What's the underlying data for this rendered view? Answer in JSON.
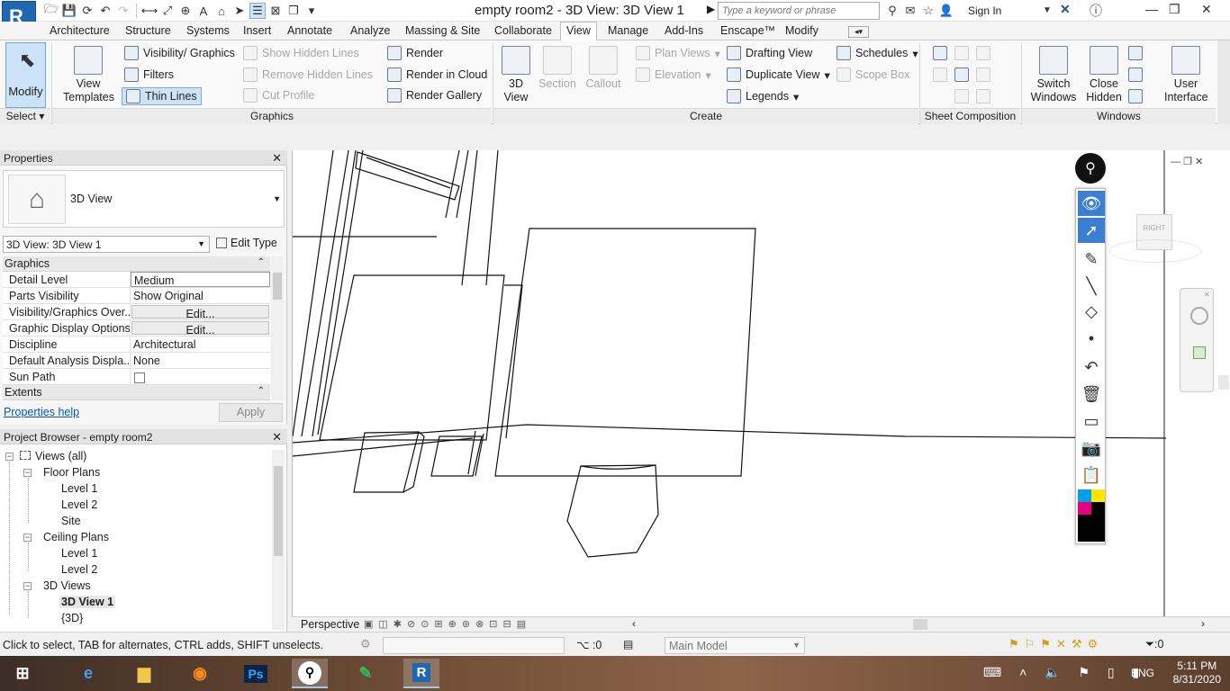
{
  "app": {
    "logo_letter": "R",
    "title": "empty room2 - 3D View: 3D View 1",
    "search_placeholder": "Type a keyword or phrase",
    "sign_in": "Sign In"
  },
  "tabs": [
    "Architecture",
    "Structure",
    "Systems",
    "Insert",
    "Annotate",
    "Analyze",
    "Massing & Site",
    "Collaborate",
    "View",
    "Manage",
    "Add-Ins",
    "Enscape™",
    "Modify"
  ],
  "active_tab": "View",
  "ribbon": {
    "select": {
      "modify": "Modify",
      "panel": "Select"
    },
    "graphics": {
      "view_templates": "View Templates",
      "visibility": "Visibility/ Graphics",
      "filters": "Filters",
      "thin_lines": "Thin Lines",
      "show_hidden": "Show  Hidden Lines",
      "remove_hidden": "Remove  Hidden Lines",
      "cut_profile": "Cut  Profile",
      "render": "Render",
      "render_cloud": "Render  in Cloud",
      "render_gallery": "Render  Gallery",
      "panel": "Graphics"
    },
    "create": {
      "view3d": "3D View",
      "section": "Section",
      "callout": "Callout",
      "plan_views": "Plan  Views",
      "elevation": "Elevation",
      "drafting": "Drafting  View",
      "duplicate": "Duplicate  View",
      "legends": "Legends",
      "schedules": "Schedules",
      "scope_box": "Scope  Box",
      "panel": "Create"
    },
    "sheet": {
      "panel": "Sheet Composition"
    },
    "windows": {
      "switch": "Switch Windows",
      "close_hidden": "Close Hidden",
      "user_interface": "User Interface",
      "panel": "Windows"
    }
  },
  "properties": {
    "title": "Properties",
    "type_name": "3D View",
    "view_selector": "3D View: 3D View 1",
    "edit_type": "Edit Type",
    "group_graphics": "Graphics",
    "rows": [
      {
        "k": "Detail Level",
        "v": "Medium"
      },
      {
        "k": "Parts Visibility",
        "v": "Show Original"
      },
      {
        "k": "Visibility/Graphics Over...",
        "v": "Edit..."
      },
      {
        "k": "Graphic Display Options",
        "v": "Edit..."
      },
      {
        "k": "Discipline",
        "v": "Architectural"
      },
      {
        "k": "Default Analysis Displa...",
        "v": "None"
      },
      {
        "k": "Sun Path",
        "v": ""
      }
    ],
    "group_extents": "Extents",
    "help": "Properties help",
    "apply": "Apply"
  },
  "browser": {
    "title": "Project Browser - empty room2",
    "root": "Views (all)",
    "floor_plans": "Floor Plans",
    "fp_items": [
      "Level 1",
      "Level 2",
      "Site"
    ],
    "ceiling_plans": "Ceiling Plans",
    "cp_items": [
      "Level 1",
      "Level 2"
    ],
    "views3d": "3D Views",
    "v3_items": [
      "3D View 1",
      "{3D}"
    ]
  },
  "viewport": {
    "perspective": "Perspective",
    "viewcube_label": "RIGHT"
  },
  "status": {
    "text": "Click to select, TAB for alternates, CTRL adds, SHIFT unselects.",
    "count1": ":0",
    "model": "Main Model",
    "count2": ":0"
  },
  "taskbar": {
    "lang": "ENG",
    "time": "5:11 PM",
    "date": "8/31/2020"
  }
}
